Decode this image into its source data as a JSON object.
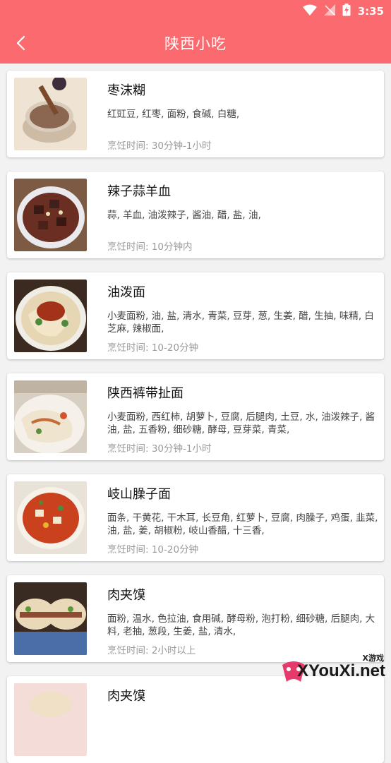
{
  "status_bar": {
    "time": "3:35"
  },
  "header": {
    "title": "陕西小吃"
  },
  "recipes": [
    {
      "name": "枣沫糊",
      "ingredients": "红豇豆, 红枣, 面粉, 食碱, 白糖,",
      "time": "烹饪时间: 30分钟-1小时"
    },
    {
      "name": "辣子蒜羊血",
      "ingredients": "蒜, 羊血, 油泼辣子, 酱油, 醋, 盐, 油,",
      "time": "烹饪时间: 10分钟内"
    },
    {
      "name": "油泼面",
      "ingredients": "小麦面粉, 油, 盐, 清水, 青菜, 豆芽, 葱, 生姜, 醋, 生抽, 味精, 白芝麻, 辣椒面,",
      "time": "烹饪时间: 10-20分钟"
    },
    {
      "name": "陕西裤带扯面",
      "ingredients": "小麦面粉, 西红柿, 胡萝卜, 豆腐, 后腿肉, 土豆, 水, 油泼辣子, 酱油, 盐, 五香粉, 细砂糖, 酵母, 豆芽菜, 青菜,",
      "time": "烹饪时间: 30分钟-1小时"
    },
    {
      "name": "岐山臊子面",
      "ingredients": "面条, 干黄花, 干木耳, 长豆角, 红萝卜, 豆腐, 肉臊子, 鸡蛋, 韭菜, 油, 盐, 姜, 胡椒粉, 岐山香醋, 十三香,",
      "time": "烹饪时间: 10-20分钟"
    },
    {
      "name": "肉夹馍",
      "ingredients": "面粉, 温水, 色拉油, 食用碱, 酵母粉, 泡打粉, 细砂糖, 后腿肉, 大料, 老抽, 葱段, 生姜, 盐, 清水,",
      "time": "烹饪时间: 2小时以上"
    },
    {
      "name": "肉夹馍",
      "ingredients": "",
      "time": ""
    }
  ],
  "watermark": {
    "top": "X游戏",
    "main": "XYouXi.net"
  },
  "colors": {
    "accent": "#fb6a6e"
  },
  "icons": [
    "wifi-icon",
    "signal-icon",
    "battery-icon",
    "back-arrow-icon"
  ]
}
